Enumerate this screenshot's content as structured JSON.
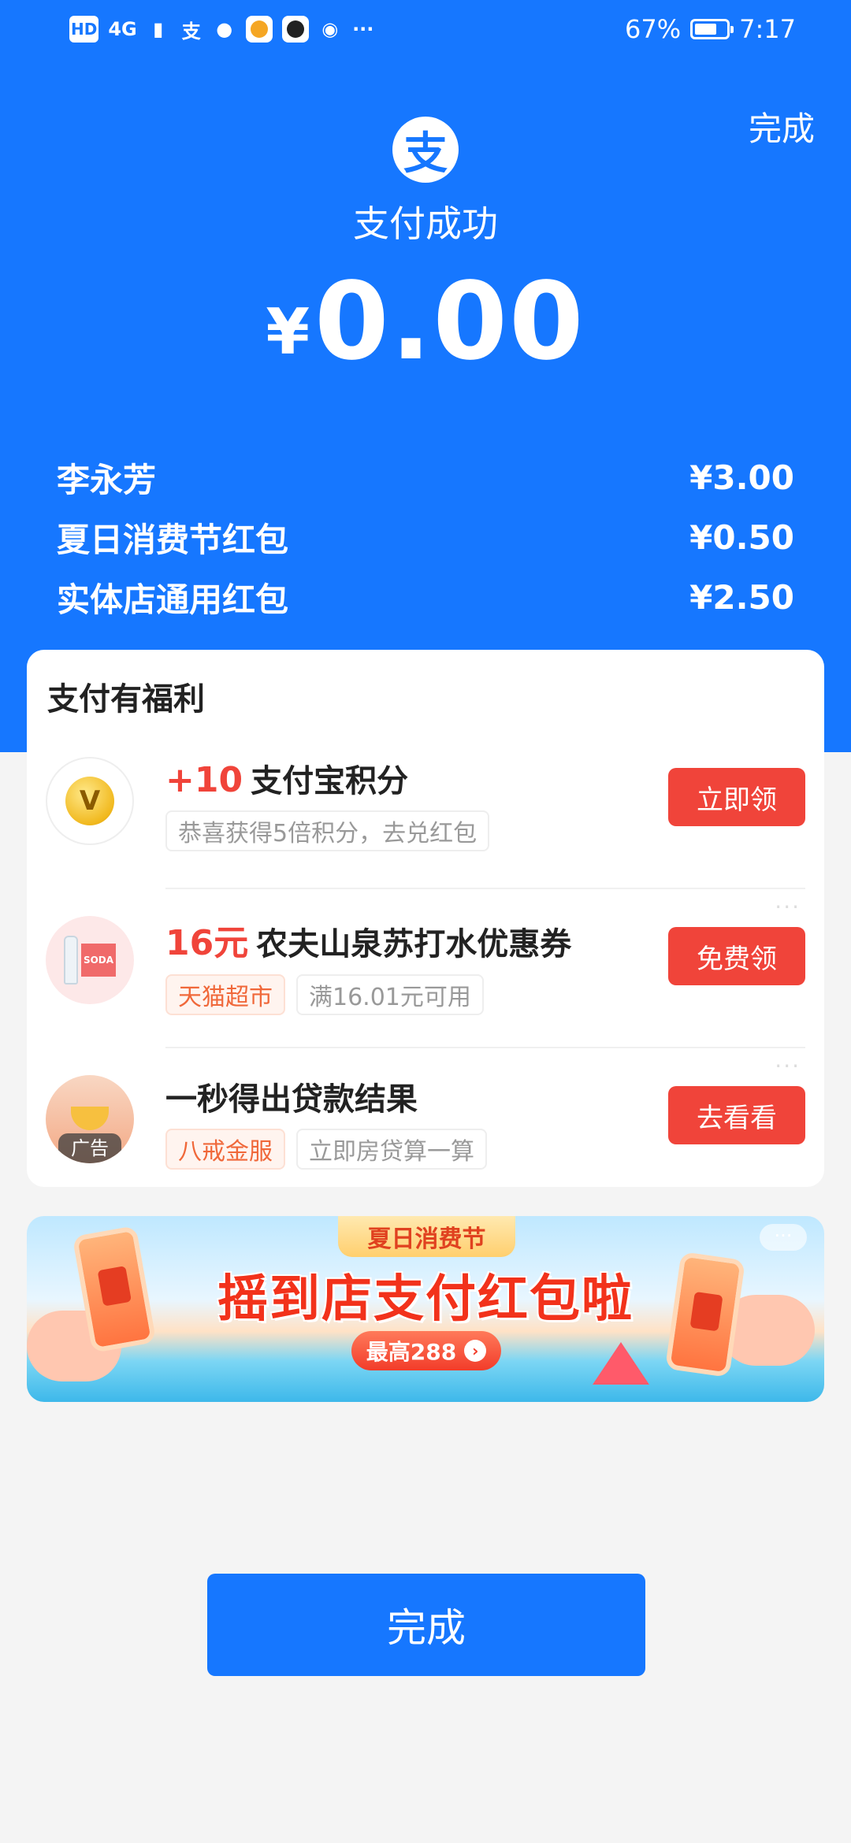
{
  "status_bar": {
    "left_icons": [
      "HD",
      "4G",
      "支"
    ],
    "battery": "67%",
    "time": "7:17",
    "more": "···"
  },
  "header": {
    "done_label": "完成",
    "logo_glyph": "支",
    "status_text": "支付成功",
    "currency": "¥",
    "amount": "0.00"
  },
  "breakdown": [
    {
      "label": "李永芳",
      "value": "¥3.00"
    },
    {
      "label": "夏日消费节红包",
      "value": "¥0.50"
    },
    {
      "label": "实体店通用红包",
      "value": "¥2.50"
    }
  ],
  "benefits": {
    "title": "支付有福利",
    "items": [
      {
        "highlight": "+10",
        "title": "支付宝积分",
        "tags": [
          "恭喜获得5倍积分，去兑红包"
        ],
        "button": "立即领",
        "icon": "points-coin-icon"
      },
      {
        "highlight": "16元",
        "title": "农夫山泉苏打水优惠券",
        "tags": [
          "天猫超市",
          "满16.01元可用"
        ],
        "button": "免费领",
        "icon": "soda-water-icon",
        "icon_box_text": "SODA"
      },
      {
        "highlight": "",
        "title": "一秒得出贷款结果",
        "tags": [
          "八戒金服",
          "立即房贷算一算"
        ],
        "button": "去看看",
        "icon": "loan-ad-icon",
        "ad_label": "广告"
      }
    ],
    "more": "···"
  },
  "banner": {
    "tag": "夏日消费节",
    "title": "摇到店支付红包啦",
    "pill": "最高288",
    "pill_arrow": "›",
    "more": "···"
  },
  "bottom": {
    "done_label": "完成"
  },
  "colors": {
    "brand_blue": "#1677ff",
    "accent_red": "#f0443a",
    "tag_orange": "#f0683a"
  }
}
